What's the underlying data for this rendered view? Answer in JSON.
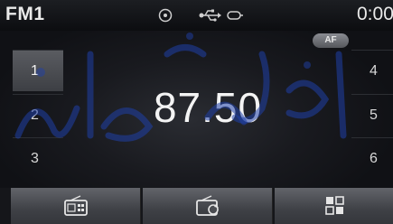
{
  "status": {
    "band": "FM1",
    "clock": "0:00",
    "icons": [
      "disc-icon",
      "usb-icon",
      "device-icon"
    ]
  },
  "af_badge": "AF",
  "frequency": "87.50",
  "presets": {
    "left": [
      "1",
      "2",
      "3"
    ],
    "right": [
      "4",
      "5",
      "6"
    ],
    "active": "1"
  },
  "bottom_buttons": [
    "radio-list-icon",
    "scan-icon",
    "menu-grid-icon"
  ],
  "colors": {
    "text": "#f4f4f4",
    "button": "#4a4c51",
    "background": "#0a0b0e"
  }
}
